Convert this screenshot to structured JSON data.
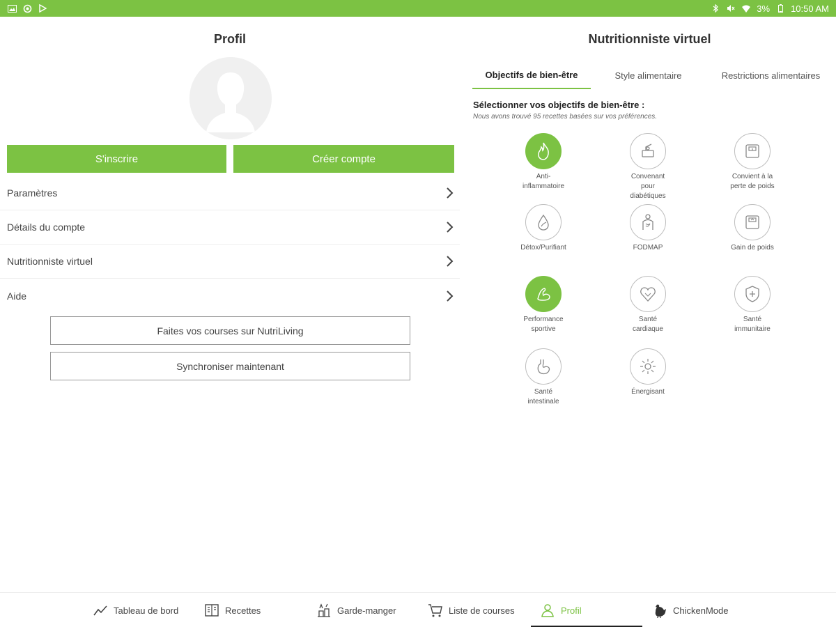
{
  "status_bar": {
    "battery": "3%",
    "time": "10:50 AM"
  },
  "profile": {
    "title": "Profil",
    "signin_label": "S'inscrire",
    "create_account_label": "Créer compte",
    "menu_items": [
      {
        "label": "Paramètres"
      },
      {
        "label": "Détails du compte"
      },
      {
        "label": "Nutritionniste virtuel"
      },
      {
        "label": "Aide"
      }
    ],
    "shop_label": "Faites vos courses sur NutriLiving",
    "sync_label": "Synchroniser maintenant"
  },
  "nutritionist": {
    "title": "Nutritionniste virtuel",
    "tabs": [
      {
        "label": "Objectifs de bien-être",
        "active": true
      },
      {
        "label": "Style alimentaire",
        "active": false
      },
      {
        "label": "Restrictions alimentaires",
        "active": false
      }
    ],
    "heading": "Sélectionner vos objectifs de bien-être :",
    "subheading": "Nous avons trouvé 95 recettes basées sur vos préférences.",
    "goals": [
      {
        "label": "Anti-\ninflammatoire",
        "icon": "flame-icon",
        "selected": true
      },
      {
        "label": "Convenant\npour\ndiabétiques",
        "icon": "glucose-meter-icon",
        "selected": false
      },
      {
        "label": "Convient à la\nperte de poids",
        "icon": "scale-icon",
        "selected": false
      },
      {
        "label": "Détox/Purifiant",
        "icon": "leaf-drop-icon",
        "selected": false
      },
      {
        "label": "FODMAP",
        "icon": "torso-icon",
        "selected": false
      },
      {
        "label": "Gain de poids",
        "icon": "scale-up-icon",
        "selected": false
      },
      {
        "label": "Performance\nsportive",
        "icon": "flexed-arm-icon",
        "selected": true
      },
      {
        "label": "Santé\ncardiaque",
        "icon": "heart-icon",
        "selected": false
      },
      {
        "label": "Santé\nimmunitaire",
        "icon": "shield-icon",
        "selected": false
      },
      {
        "label": "Santé\nintestinale",
        "icon": "stomach-icon",
        "selected": false
      },
      {
        "label": "Énergisant",
        "icon": "sun-icon",
        "selected": false
      }
    ]
  },
  "bottom_nav": [
    {
      "label": "Tableau de bord",
      "icon": "chart-line-icon"
    },
    {
      "label": "Recettes",
      "icon": "recipe-book-icon"
    },
    {
      "label": "Garde-manger",
      "icon": "pantry-icon"
    },
    {
      "label": "Liste de courses",
      "icon": "cart-icon"
    },
    {
      "label": "Profil",
      "icon": "person-icon",
      "active": true
    },
    {
      "label": "ChickenMode",
      "icon": "chicken-icon"
    }
  ],
  "colors": {
    "accent": "#7cc243",
    "text": "#333333"
  }
}
